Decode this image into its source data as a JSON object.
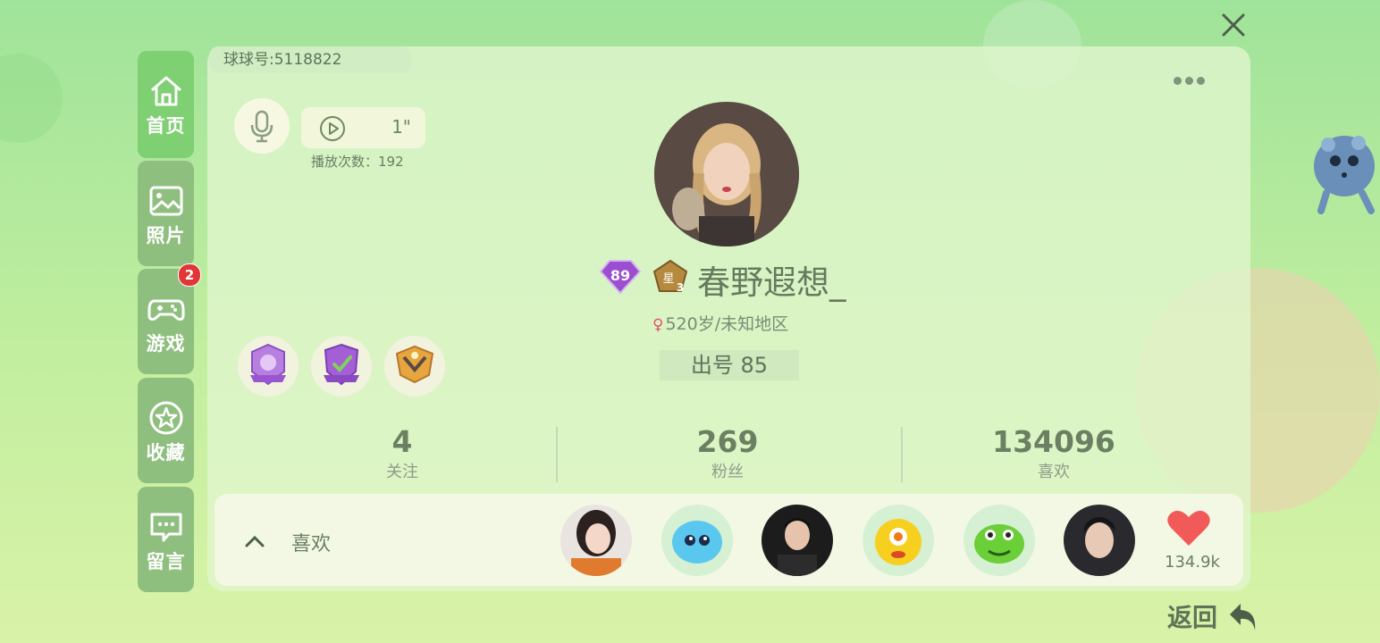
{
  "window": {
    "close_icon": "close-icon"
  },
  "sidebar": {
    "items": [
      {
        "label": "首页",
        "icon": "home-icon",
        "active": true
      },
      {
        "label": "照片",
        "icon": "photo-icon"
      },
      {
        "label": "游戏",
        "icon": "gamepad-icon",
        "badge": "2"
      },
      {
        "label": "收藏",
        "icon": "star-icon"
      },
      {
        "label": "留言",
        "icon": "message-icon"
      }
    ]
  },
  "profile": {
    "uid": "球球号:5118822",
    "voice": {
      "duration": "1\"",
      "plays": "播放次数：192"
    },
    "level": "89",
    "star_level": "3",
    "nickname": "春野遐想_",
    "gender_symbol": "♀",
    "location": "520岁/未知地区",
    "chuhao": "出号  85",
    "stats": [
      {
        "value": "4",
        "label": "关注"
      },
      {
        "value": "269",
        "label": "粉丝"
      },
      {
        "value": "134096",
        "label": "喜欢"
      }
    ],
    "likes": {
      "label": "喜欢",
      "count": "134.9k"
    }
  },
  "nav": {
    "back_label": "返回"
  },
  "colors": {
    "accent_green": "#7fcf73",
    "heart_red": "#f25a5a",
    "text_green": "#657a5e"
  }
}
